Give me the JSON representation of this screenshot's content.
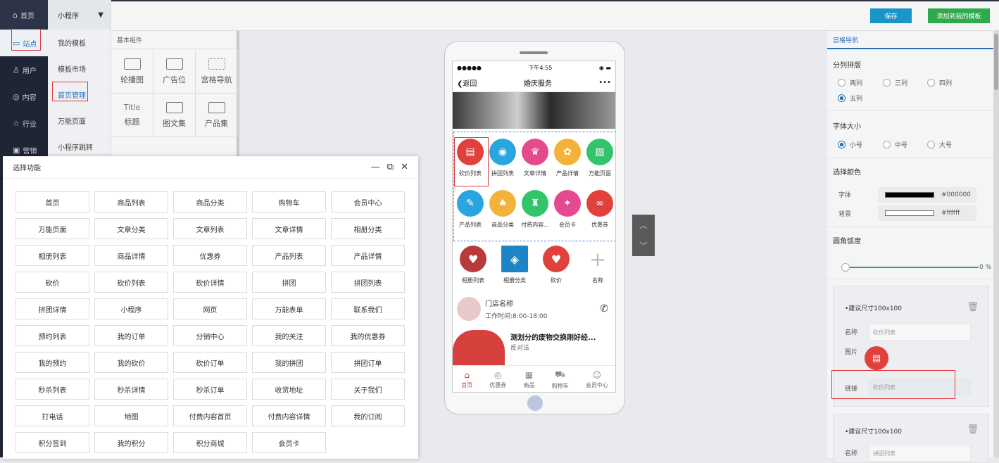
{
  "nav": {
    "items": [
      {
        "label": "首页",
        "icon": "home-icon"
      },
      {
        "label": "站点",
        "icon": "monitor-icon"
      },
      {
        "label": "用户",
        "icon": "user-icon"
      },
      {
        "label": "内容",
        "icon": "content-icon"
      },
      {
        "label": "行业",
        "icon": "star-icon"
      },
      {
        "label": "营销",
        "icon": "calendar-icon"
      }
    ]
  },
  "subnav": {
    "header": "小程序",
    "items": [
      "我的模板",
      "模板市场",
      "首页管理",
      "万能页面",
      "小程序跳转"
    ]
  },
  "components": {
    "title": "基本组件",
    "tiles": [
      "轮播图",
      "广告位",
      "宫格导航",
      "标题",
      "图文集",
      "产品集"
    ],
    "title_tile_caption": "Title"
  },
  "modal": {
    "title": "选择功能",
    "functions": [
      "首页",
      "商品列表",
      "商品分类",
      "购物车",
      "会员中心",
      "万能页面",
      "文章分类",
      "文章列表",
      "文章详情",
      "相册分类",
      "相册列表",
      "商品详情",
      "优惠券",
      "产品列表",
      "产品详情",
      "砍价",
      "砍价列表",
      "砍价详情",
      "拼团",
      "拼团列表",
      "拼团详情",
      "小程序",
      "网页",
      "万能表单",
      "联系我们",
      "预约列表",
      "我的订单",
      "分销中心",
      "我的关注",
      "我的优惠券",
      "我的预约",
      "我的砍价",
      "砍价订单",
      "我的拼团",
      "拼团订单",
      "秒杀列表",
      "秒杀详情",
      "秒杀订单",
      "收货地址",
      "关于我们",
      "打电话",
      "地图",
      "付费内容首页",
      "付费内容详情",
      "我的订阅",
      "积分签到",
      "我的积分",
      "积分商城",
      "会员卡"
    ]
  },
  "phone": {
    "status_carrier": "●●●●●",
    "status_time": "下午4:55",
    "back_label": "返回",
    "page_title": "婚庆服务",
    "more": "•••",
    "grid_row1": [
      "砍价列表",
      "拼团列表",
      "文章详情",
      "产品详情",
      "万能页面"
    ],
    "grid_row2": [
      "产品列表",
      "商品分类",
      "付费内容...",
      "会员卡",
      "优惠券"
    ],
    "grid_row3": [
      "相册列表",
      "相册分类",
      "砍价",
      "名称"
    ],
    "store_name": "门店名称",
    "store_hours": "工作时间:8:00-18:00",
    "article_title": "测划分的废物交换刚好经...",
    "article_sub": "反对法",
    "tabs": [
      "首页",
      "优惠券",
      "商品",
      "购物车",
      "会员中心"
    ]
  },
  "toolbar": {
    "save_label": "保存",
    "add_label": "添加到我的模板"
  },
  "right": {
    "tab": "宫格导航",
    "layout_title": "分列排版",
    "layout_options": [
      "两列",
      "三列",
      "四列",
      "五列"
    ],
    "font_title": "字体大小",
    "font_options": [
      "小号",
      "中号",
      "大号"
    ],
    "color_title": "选择颜色",
    "font_color_label": "字体",
    "font_color_value": "#000000",
    "bg_color_label": "背景",
    "bg_color_value": "#ffffff",
    "radius_title": "圆角弧度",
    "radius_value": "0 %",
    "card1": {
      "hint": "•建议尺寸100x100",
      "name_label": "名称",
      "name_value": "砍价列表",
      "img_label": "图片",
      "link_label": "链接",
      "link_value": "砍价列表"
    },
    "card2": {
      "hint": "•建议尺寸100x100",
      "name_label": "名称",
      "name_value": "拼团列表"
    }
  },
  "colors": {
    "accent": "#2a6fb5",
    "nav_bg": "#1f2535",
    "save": "#1995c9",
    "add": "#2ea94e",
    "highlight": "#e0393e"
  }
}
